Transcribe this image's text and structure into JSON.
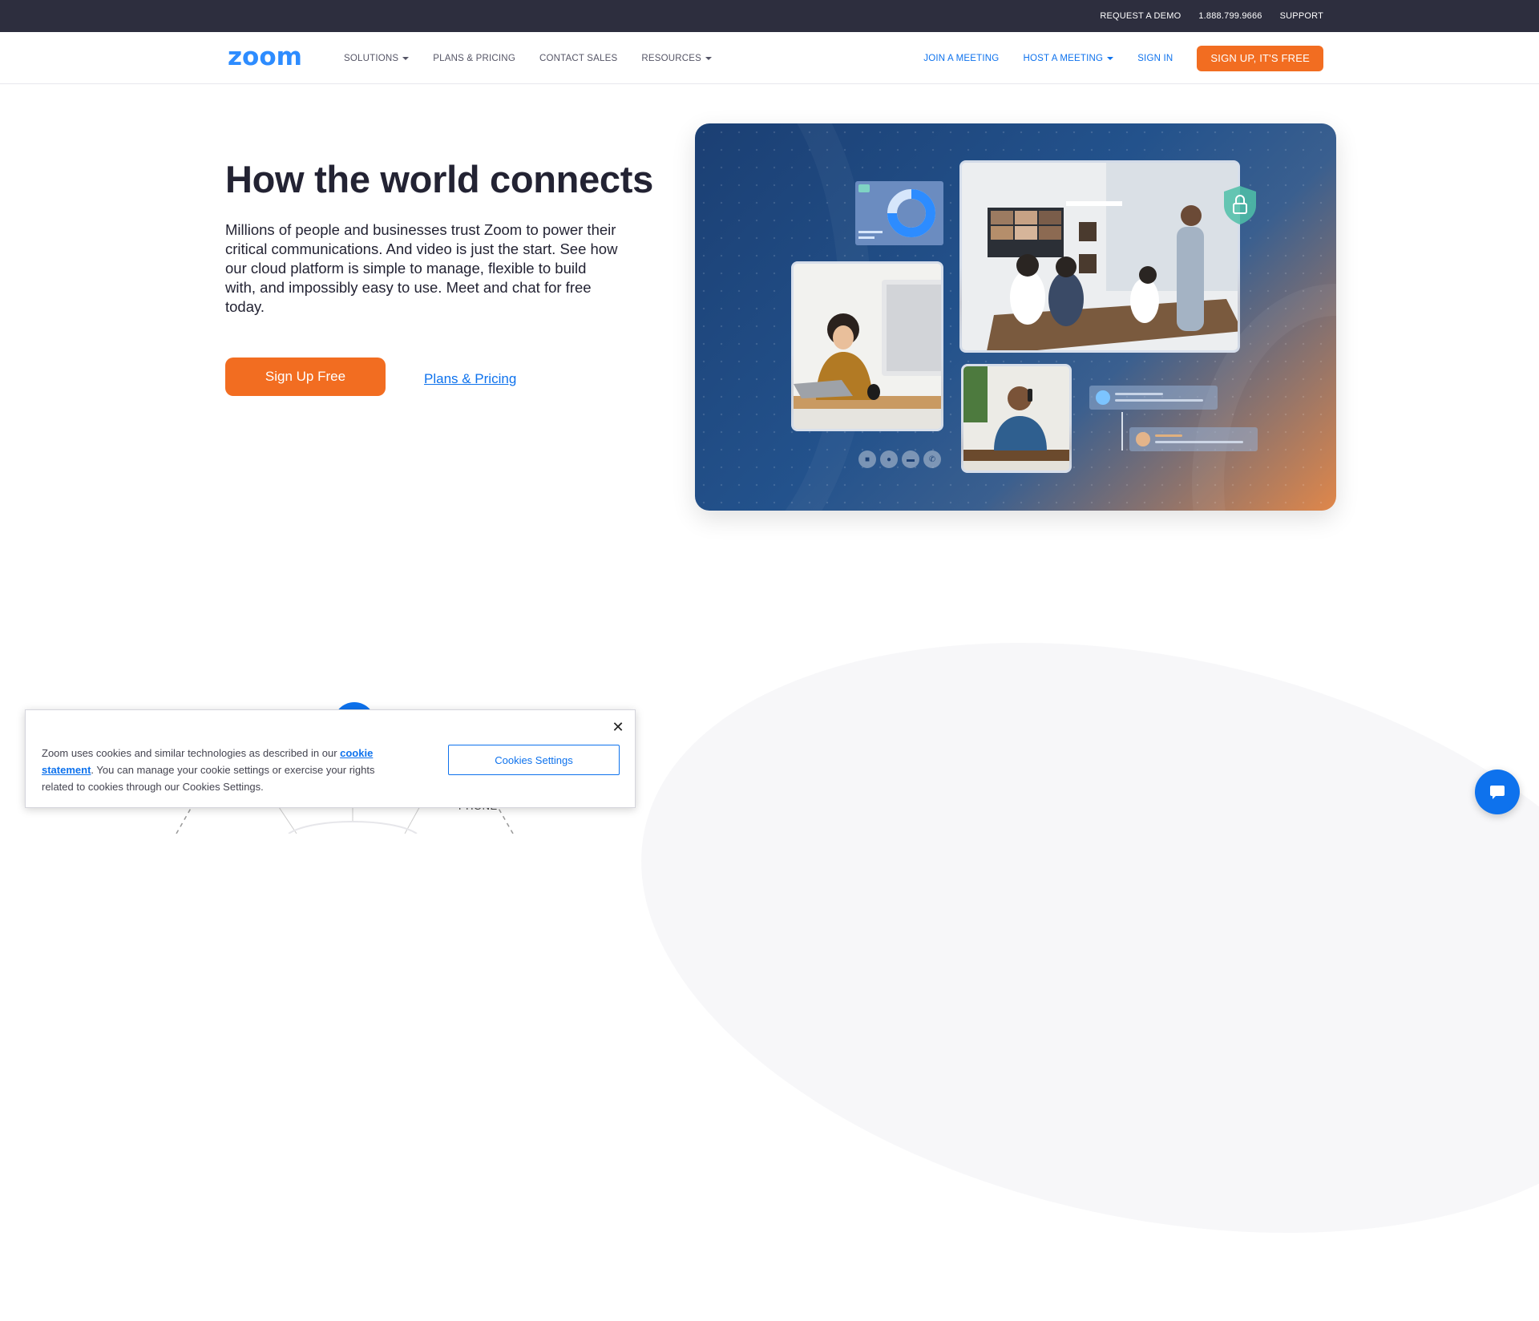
{
  "topbar": {
    "links": [
      "REQUEST A DEMO",
      "1.888.799.9666",
      "SUPPORT"
    ]
  },
  "nav": {
    "logo_text": "zoom",
    "left": [
      {
        "label": "SOLUTIONS",
        "dropdown": true
      },
      {
        "label": "PLANS & PRICING",
        "dropdown": false
      },
      {
        "label": "CONTACT SALES",
        "dropdown": false
      },
      {
        "label": "RESOURCES",
        "dropdown": true
      }
    ],
    "right": [
      {
        "label": "JOIN A MEETING",
        "dropdown": false
      },
      {
        "label": "HOST A MEETING",
        "dropdown": true
      },
      {
        "label": "SIGN IN",
        "dropdown": false
      }
    ],
    "signup_label": "SIGN UP, IT'S FREE"
  },
  "hero": {
    "title": "How the world connects",
    "text": "Millions of people and businesses trust Zoom to power their critical communications. And video is just the start. See how our cloud platform is simple to manage, flexible to build with, and impossibly easy to use. Meet and chat for free today.",
    "primary_button": "Sign Up Free",
    "secondary_link": "Plans & Pricing"
  },
  "diagram": {
    "phone_label": "PHONE"
  },
  "cookie": {
    "text_before": "Zoom uses cookies and similar technologies as described in our ",
    "link_text": "cookie statement",
    "text_after": ". You can manage your cookie settings or exercise your rights related to cookies through our Cookies Settings.",
    "settings_button": "Cookies Settings"
  },
  "colors": {
    "brand_blue": "#0e72ed",
    "brand_orange": "#f26d21",
    "topbar_bg": "#2d2e3e"
  },
  "icons": {
    "close": "close-icon",
    "chat": "chat-bubble-icon",
    "caret": "caret-down-icon"
  }
}
